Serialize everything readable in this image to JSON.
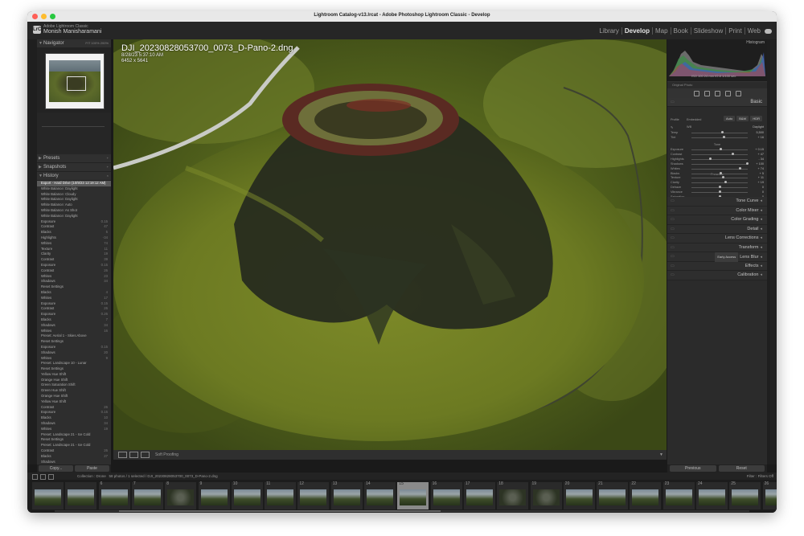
{
  "window": {
    "title": "Lightroom Catalog-v13.lrcat - Adobe Photoshop Lightroom Classic - Develop",
    "traffic_colors": [
      "#ff5f57",
      "#febc2e",
      "#28c840"
    ]
  },
  "identity": {
    "logo": "LrC",
    "line1": "Adobe Lightroom Classic",
    "user": "Monish Manisharamani"
  },
  "modules": [
    "Library",
    "Develop",
    "Map",
    "Book",
    "Slideshow",
    "Print",
    "Web"
  ],
  "active_module": "Develop",
  "left": {
    "navigator": "Navigator",
    "nav_zoom": "FIT  100%  200%",
    "presets": "Presets",
    "snapshots": "Snapshots",
    "history": "History",
    "history_items": [
      {
        "label": "Export - Hard Drive (10/9/23 12:19:12 AM)",
        "val": ""
      },
      {
        "label": "White Balance: Daylight",
        "val": ""
      },
      {
        "label": "White Balance: Cloudy",
        "val": ""
      },
      {
        "label": "White Balance: Daylight",
        "val": ""
      },
      {
        "label": "White Balance: Auto",
        "val": ""
      },
      {
        "label": "White Balance: As Shot",
        "val": ""
      },
      {
        "label": "White Balance: Daylight",
        "val": ""
      },
      {
        "label": "Exposure",
        "val": "0.15"
      },
      {
        "label": "Contrast",
        "val": "47"
      },
      {
        "label": "Blacks",
        "val": "5"
      },
      {
        "label": "Highlights",
        "val": "-34"
      },
      {
        "label": "Whites",
        "val": "74"
      },
      {
        "label": "Texture",
        "val": "11"
      },
      {
        "label": "Clarity",
        "val": "19"
      },
      {
        "label": "Contrast",
        "val": "39"
      },
      {
        "label": "Exposure",
        "val": "0.15"
      },
      {
        "label": "Contrast",
        "val": "26"
      },
      {
        "label": "Whites",
        "val": "23"
      },
      {
        "label": "Shadows",
        "val": "34"
      },
      {
        "label": "Reset Settings",
        "val": ""
      },
      {
        "label": "Blacks",
        "val": "4"
      },
      {
        "label": "Whites",
        "val": "17"
      },
      {
        "label": "Exposure",
        "val": "0.15"
      },
      {
        "label": "Contrast",
        "val": "26"
      },
      {
        "label": "Exposure",
        "val": "0.26"
      },
      {
        "label": "Blacks",
        "val": "7"
      },
      {
        "label": "Shadows",
        "val": "34"
      },
      {
        "label": "Whites",
        "val": "16"
      },
      {
        "label": "Preset: Aerial 1 - Skies Above",
        "val": ""
      },
      {
        "label": "Reset Settings",
        "val": ""
      },
      {
        "label": "Exposure",
        "val": "0.15"
      },
      {
        "label": "Shadows",
        "val": "20"
      },
      {
        "label": "Whites",
        "val": "9"
      },
      {
        "label": "Preset: Landscape 10 - Lunar",
        "val": ""
      },
      {
        "label": "Reset Settings",
        "val": ""
      },
      {
        "label": "Yellow Hue Shift",
        "val": ""
      },
      {
        "label": "Orange Hue Shift",
        "val": ""
      },
      {
        "label": "Green Saturation Shift",
        "val": ""
      },
      {
        "label": "Green Hue Shift",
        "val": ""
      },
      {
        "label": "Orange Hue Shift",
        "val": ""
      },
      {
        "label": "Yellow Hue Shift",
        "val": ""
      },
      {
        "label": "Contrast",
        "val": "26"
      },
      {
        "label": "Exposure",
        "val": "0.15"
      },
      {
        "label": "Blacks",
        "val": "10"
      },
      {
        "label": "Shadows",
        "val": "34"
      },
      {
        "label": "Whites",
        "val": "19"
      },
      {
        "label": "Preset: Landscape 21 - Ice Cold",
        "val": ""
      },
      {
        "label": "Reset Settings",
        "val": ""
      },
      {
        "label": "Preset: Landscape 21 - Ice Cold",
        "val": ""
      },
      {
        "label": "Contrast",
        "val": "26"
      },
      {
        "label": "Blacks",
        "val": "27"
      },
      {
        "label": "Shadows",
        "val": ""
      }
    ],
    "copy": "Copy...",
    "paste": "Paste"
  },
  "canvas": {
    "filename": "DJI_20230828053700_0073_D-Pano-2.dng",
    "datetime": "8/28/23 5:37:10 AM",
    "dimensions": "6452 x 5641"
  },
  "toolbar": {
    "soft_proofing": "Soft Proofing"
  },
  "right": {
    "histogram": "Histogram",
    "hist_stats": "ISO 100   24 mm   f/2.8   1/100 sec",
    "original_photo": "Original Photo",
    "basic": "Basic",
    "treatment": [
      "Auto",
      "B&W",
      "HDR"
    ],
    "profile_label": "Profile",
    "profile_value": "Embedded",
    "wb_label": "WB",
    "wb_value": "Daylight",
    "sliders": [
      {
        "label": "Temp",
        "val": "5,500",
        "pos": 0.55
      },
      {
        "label": "Tint",
        "val": "+ 16",
        "pos": 0.58
      },
      {
        "label": "Exposure",
        "val": "+ 0.15",
        "pos": 0.52
      },
      {
        "label": "Contrast",
        "val": "+ 47",
        "pos": 0.74
      },
      {
        "label": "Highlights",
        "val": "- 34",
        "pos": 0.33
      },
      {
        "label": "Shadows",
        "val": "+ 100",
        "pos": 1.0
      },
      {
        "label": "Whites",
        "val": "+ 74",
        "pos": 0.87
      },
      {
        "label": "Blacks",
        "val": "+ 5",
        "pos": 0.52
      },
      {
        "label": "Texture",
        "val": "+ 11",
        "pos": 0.56
      },
      {
        "label": "Clarity",
        "val": "+ 19",
        "pos": 0.6
      },
      {
        "label": "Dehaze",
        "val": "0",
        "pos": 0.5
      },
      {
        "label": "Vibrance",
        "val": "0",
        "pos": 0.5
      },
      {
        "label": "Saturation",
        "val": "0",
        "pos": 0.5
      }
    ],
    "tone_label": "Tone",
    "presence_label": "Presence",
    "sections": [
      "Tone Curve",
      "Color Mixer",
      "Color Grading",
      "Detail",
      "Lens Corrections",
      "Transform",
      "Lens Blur",
      "Effects",
      "Calibration"
    ],
    "early_access": "Early Access",
    "previous": "Previous",
    "reset": "Reset"
  },
  "filmstrip": {
    "source": "Collection : Drone",
    "count": "58 photos / 1 selected / DJI_20230828053700_0073_D-Pano-2.dng",
    "filter": "Filter :",
    "filter_value": "Filters Off",
    "numbers": [
      "",
      "",
      "6",
      "7",
      "8",
      "9",
      "10",
      "11",
      "12",
      "13",
      "14",
      "15",
      "16",
      "17",
      "18",
      "19",
      "20",
      "21",
      "22",
      "23",
      "24",
      "25",
      "26"
    ],
    "selected_number": "15"
  }
}
